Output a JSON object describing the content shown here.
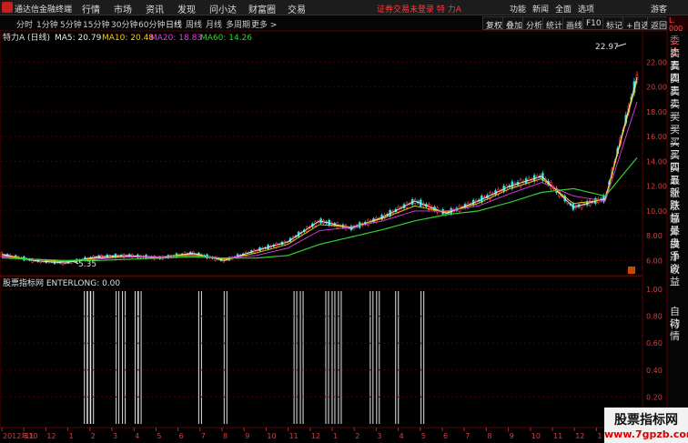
{
  "menubar": {
    "app_title": "通达信金融终端",
    "menu_items": [
      "行情",
      "市场",
      "资讯",
      "发现",
      "问小达",
      "财富圈",
      "交易"
    ],
    "warning": "证券交易未登录  特 力A",
    "right_items": [
      "功能",
      "新闻",
      "全面",
      "选项"
    ],
    "user": "游客"
  },
  "periodbar": {
    "periods": [
      "分时",
      "1分钟",
      "5分钟",
      "15分钟",
      "30分钟",
      "60分钟",
      "日线",
      "周线",
      "月线",
      "多周期",
      "更多 >"
    ],
    "active_period": "日线",
    "tools": [
      "复权",
      "叠加",
      "分析",
      "统计",
      "画线",
      "F10",
      "标记",
      "+自选",
      "返回"
    ]
  },
  "main_chart": {
    "stock_label": "特力A (日线)",
    "ma_legend": [
      {
        "label": "MA5: 20.79",
        "color": "#e8e8e8"
      },
      {
        "label": "MA10: 20.48",
        "color": "#f0d000"
      },
      {
        "label": "MA20: 18.83",
        "color": "#e040e0"
      },
      {
        "label": "MA60: 14.26",
        "color": "#30d030"
      }
    ],
    "y_ticks": [
      "22.00",
      "20.00",
      "18.00",
      "16.00",
      "14.00",
      "12.00",
      "10.00",
      "8.00",
      "6.00"
    ],
    "high_label": "22.97",
    "low_label": "5.35"
  },
  "indicator": {
    "title": "股票指标网  ENTERLONG: 0.00",
    "y_ticks": [
      "1.00",
      "0.80",
      "0.60",
      "0.40",
      "0.20"
    ]
  },
  "x_axis": {
    "labels": [
      "2012年10",
      "11",
      "12",
      "1",
      "2",
      "3",
      "4",
      "5",
      "6",
      "7",
      "8",
      "9",
      "10",
      "11",
      "12",
      "1",
      "2",
      "3",
      "4",
      "5",
      "6",
      "7",
      "8",
      "9",
      "10",
      "11",
      "12",
      "1",
      "2"
    ]
  },
  "right_panel": {
    "items": [
      "委比",
      "卖五",
      "卖四",
      "卖三",
      "卖二",
      "卖一",
      "买一",
      "买二",
      "买三",
      "买四",
      "买五",
      "最新",
      "涨跌",
      "涨幅",
      "总量",
      "外盘",
      "换手",
      "净资",
      "收益"
    ],
    "items_bottom": [
      "自动",
      "行情"
    ],
    "badge": "L. 000"
  },
  "watermark": {
    "line1": "股票指标网",
    "line2": "www.7gpzb.com"
  },
  "chart_data": {
    "type": "line",
    "title": "特力A (日线)",
    "x": [
      0,
      5,
      10,
      15,
      20,
      25,
      30,
      35,
      40,
      45,
      50,
      55,
      60,
      65,
      70,
      75,
      80,
      85,
      90,
      95,
      100
    ],
    "series": [
      {
        "name": "MA5",
        "values": [
          6.5,
          6.0,
          5.8,
          6.3,
          6.4,
          6.2,
          6.6,
          6.0,
          6.8,
          7.5,
          9.2,
          8.6,
          9.5,
          10.8,
          9.8,
          10.8,
          12.0,
          12.8,
          10.3,
          11.0,
          20.8
        ]
      },
      {
        "name": "MA10",
        "values": [
          6.4,
          6.1,
          5.9,
          6.2,
          6.3,
          6.3,
          6.5,
          6.1,
          6.6,
          7.3,
          8.9,
          8.7,
          9.4,
          10.4,
          9.9,
          10.6,
          11.8,
          12.6,
          10.6,
          10.9,
          20.5
        ]
      },
      {
        "name": "MA20",
        "values": [
          6.3,
          6.1,
          6.0,
          6.1,
          6.3,
          6.3,
          6.4,
          6.2,
          6.4,
          7.0,
          8.4,
          8.7,
          9.2,
          10.0,
          10.0,
          10.4,
          11.4,
          12.3,
          11.2,
          10.8,
          18.8
        ]
      },
      {
        "name": "MA60",
        "values": [
          6.2,
          6.1,
          6.0,
          6.0,
          6.1,
          6.2,
          6.3,
          6.2,
          6.2,
          6.4,
          7.3,
          7.9,
          8.5,
          9.2,
          9.7,
          10.0,
          10.7,
          11.5,
          11.8,
          11.2,
          14.3
        ]
      }
    ],
    "ylim": [
      5.0,
      23.5
    ],
    "annotations": [
      "22.97",
      "5.35"
    ],
    "enterlong_signals": [
      0.13,
      0.135,
      0.14,
      0.18,
      0.19,
      0.21,
      0.215,
      0.31,
      0.35,
      0.46,
      0.47,
      0.51,
      0.52,
      0.53,
      0.58,
      0.59,
      0.62,
      0.66
    ]
  }
}
